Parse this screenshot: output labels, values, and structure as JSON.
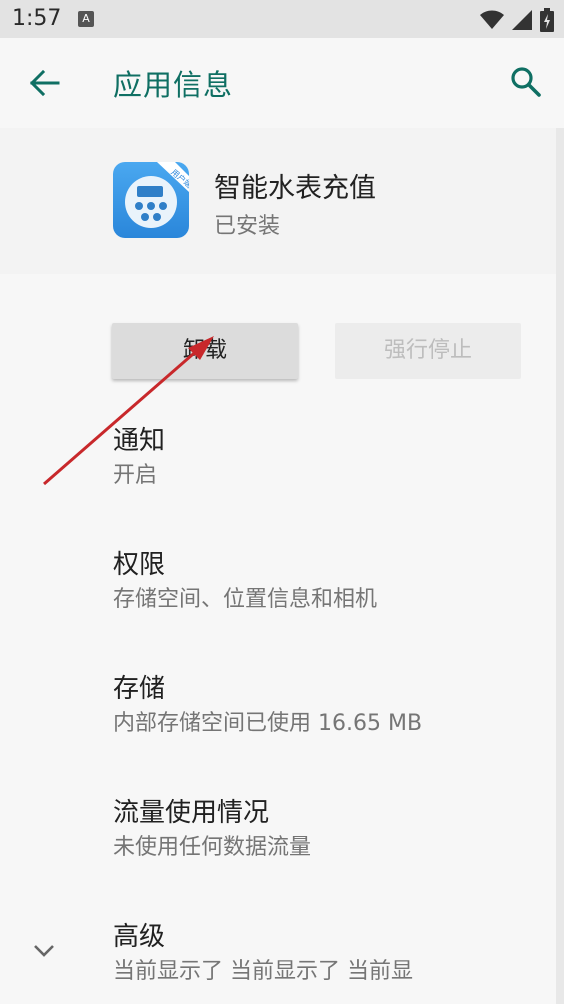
{
  "status_bar": {
    "time": "1:57",
    "notification_letter": "A",
    "icons": [
      "wifi-icon",
      "signal-icon",
      "battery-icon"
    ]
  },
  "toolbar": {
    "title": "应用信息",
    "back_icon": "arrow-back-icon",
    "search_icon": "search-icon",
    "accent_color": "#0f6f63"
  },
  "app": {
    "name": "智能水表充值",
    "status": "已安装",
    "icon_badge": "用户端"
  },
  "buttons": {
    "uninstall": "卸载",
    "force_stop": "强行停止"
  },
  "prefs": [
    {
      "title": "通知",
      "summary": "开启"
    },
    {
      "title": "权限",
      "summary": "存储空间、位置信息和相机"
    },
    {
      "title": "存储",
      "summary": "内部存储空间已使用 16.65 MB"
    },
    {
      "title": "流量使用情况",
      "summary": "未使用任何数据流量"
    },
    {
      "title": "高级",
      "summary": "当前显示了 当前显示了 当前显"
    }
  ],
  "annotation": {
    "arrow_color": "#c8282b"
  }
}
